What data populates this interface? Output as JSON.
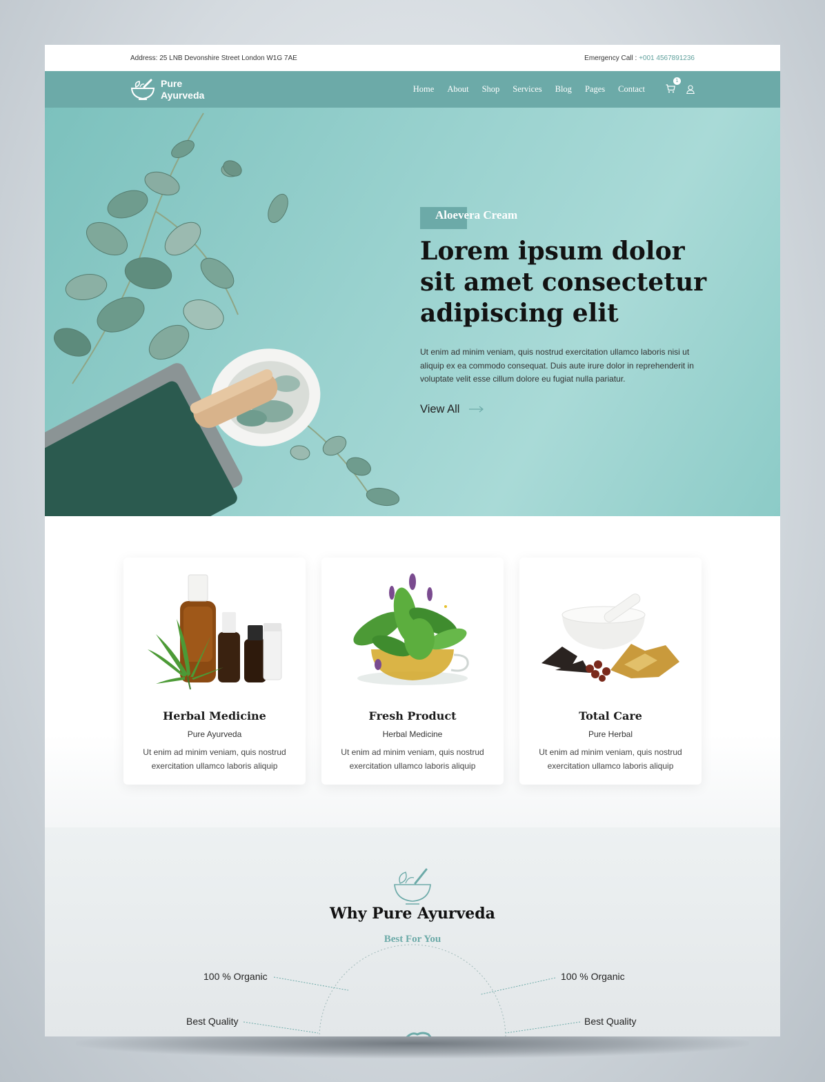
{
  "topbar": {
    "address": "Address: 25 LNB Devonshire Street London W1G 7AE",
    "emergency_label": "Emergency Call : ",
    "emergency_phone": "+001 4567891236"
  },
  "brand": {
    "line1": "Pure",
    "line2": "Ayurveda"
  },
  "nav": {
    "items": [
      "Home",
      "About",
      "Shop",
      "Services",
      "Blog",
      "Pages",
      "Contact"
    ],
    "cart_count": "1"
  },
  "hero": {
    "tag": "Aloevera Cream",
    "title": "Lorem ipsum dolor sit amet consectetur adipiscing elit",
    "text": "Ut enim ad minim veniam, quis nostrud exercitation ullamco laboris nisi ut aliquip ex ea commodo consequat. Duis aute irure dolor in reprehenderit in voluptate velit esse cillum dolore eu fugiat nulla pariatur.",
    "cta": "View All"
  },
  "cards": [
    {
      "title": "Herbal Medicine",
      "subtitle": "Pure Ayurveda",
      "text": "Ut enim ad minim veniam, quis nostrud exercitation ullamco laboris aliquip"
    },
    {
      "title": "Fresh Product",
      "subtitle": "Herbal Medicine",
      "text": "Ut enim ad minim veniam, quis nostrud exercitation ullamco laboris aliquip"
    },
    {
      "title": "Total Care",
      "subtitle": "Pure Herbal",
      "text": "Ut enim ad minim veniam, quis nostrud exercitation ullamco laboris aliquip"
    }
  ],
  "why": {
    "title": "Why Pure Ayurveda",
    "subtitle": "Best For You",
    "features_left": [
      "100 % Organic",
      "Best Quality"
    ],
    "features_right": [
      "100 % Organic",
      "Best Quality"
    ]
  },
  "colors": {
    "primary": "#6caaa8",
    "hero_bg": "#9ad2cf",
    "dark_text": "#121212"
  }
}
